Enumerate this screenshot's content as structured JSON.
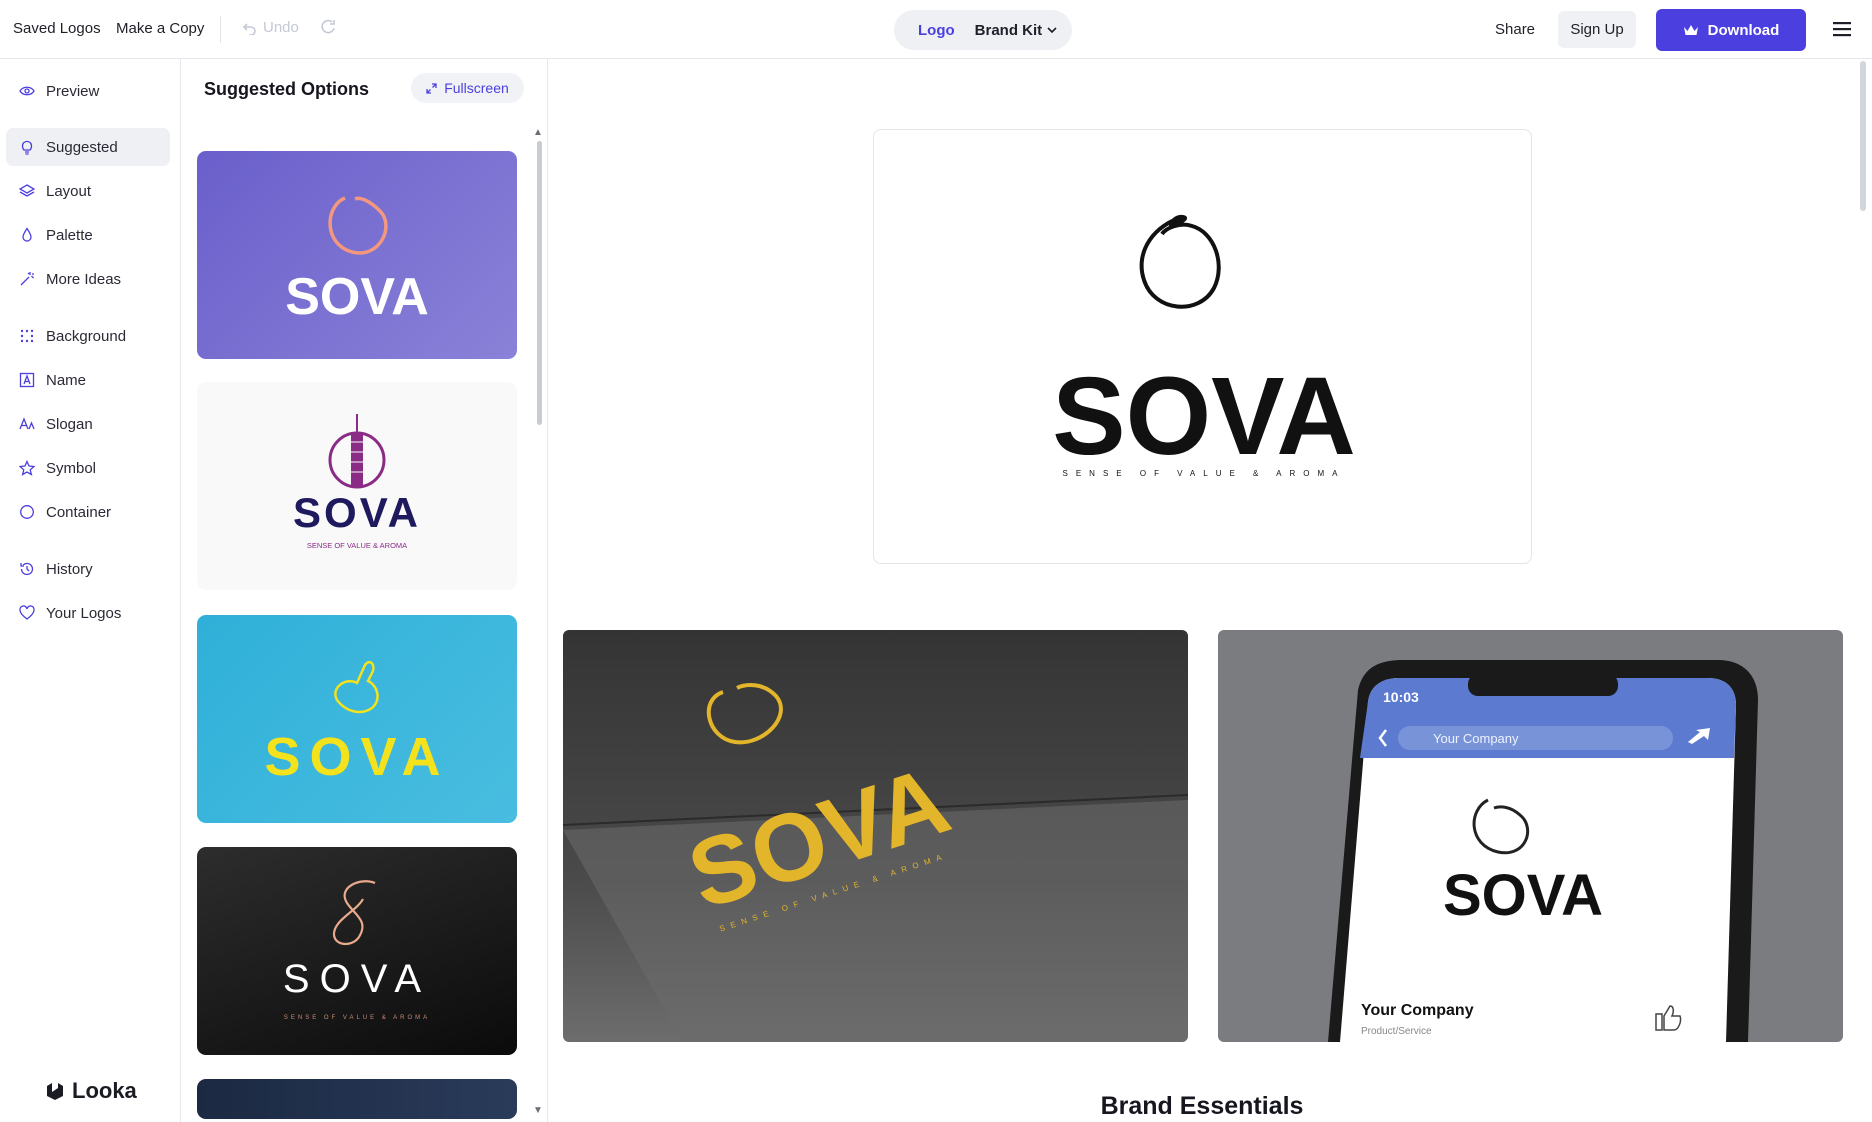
{
  "topbar": {
    "saved_logos": "Saved Logos",
    "make_copy": "Make a Copy",
    "undo": "Undo",
    "toggle_logo": "Logo",
    "toggle_brand_kit": "Brand Kit",
    "share": "Share",
    "sign_up": "Sign Up",
    "download": "Download"
  },
  "nav": {
    "items": [
      {
        "label": "Preview",
        "icon": "eye-icon"
      },
      {
        "label": "Suggested",
        "icon": "lightbulb-icon"
      },
      {
        "label": "Layout",
        "icon": "layers-icon"
      },
      {
        "label": "Palette",
        "icon": "droplet-icon"
      },
      {
        "label": "More Ideas",
        "icon": "magic-wand-icon"
      },
      {
        "label": "Background",
        "icon": "grid-icon"
      },
      {
        "label": "Name",
        "icon": "text-box-icon"
      },
      {
        "label": "Slogan",
        "icon": "font-icon"
      },
      {
        "label": "Symbol",
        "icon": "star-icon"
      },
      {
        "label": "Container",
        "icon": "circle-icon"
      },
      {
        "label": "History",
        "icon": "history-icon"
      },
      {
        "label": "Your Logos",
        "icon": "heart-icon"
      }
    ],
    "brand": "Looka"
  },
  "panel": {
    "title": "Suggested Options",
    "fullscreen": "Fullscreen",
    "cards": [
      {
        "name": "SOVA",
        "slogan": ""
      },
      {
        "name": "SOVA",
        "slogan": "SENSE OF VALUE & AROMA"
      },
      {
        "name": "SOVA",
        "slogan": ""
      },
      {
        "name": "SOVA",
        "slogan": "SENSE OF VALUE & AROMA"
      }
    ]
  },
  "main": {
    "logo_name": "SOVA",
    "logo_slogan": "SENSE OF VALUE & AROMA",
    "phone": {
      "time": "10:03",
      "search": "Your Company",
      "company": "Your Company",
      "subtitle": "Product/Service"
    },
    "section_title": "Brand Essentials"
  },
  "colors": {
    "accent": "#4b3fe0",
    "card1_bg": "#6f64cf",
    "card2_text": "#1f1a5e",
    "card3_bg": "#35b3da",
    "card3_text": "#f4e21c",
    "card4_bg": "#141414",
    "gold": "#e3b52a"
  }
}
